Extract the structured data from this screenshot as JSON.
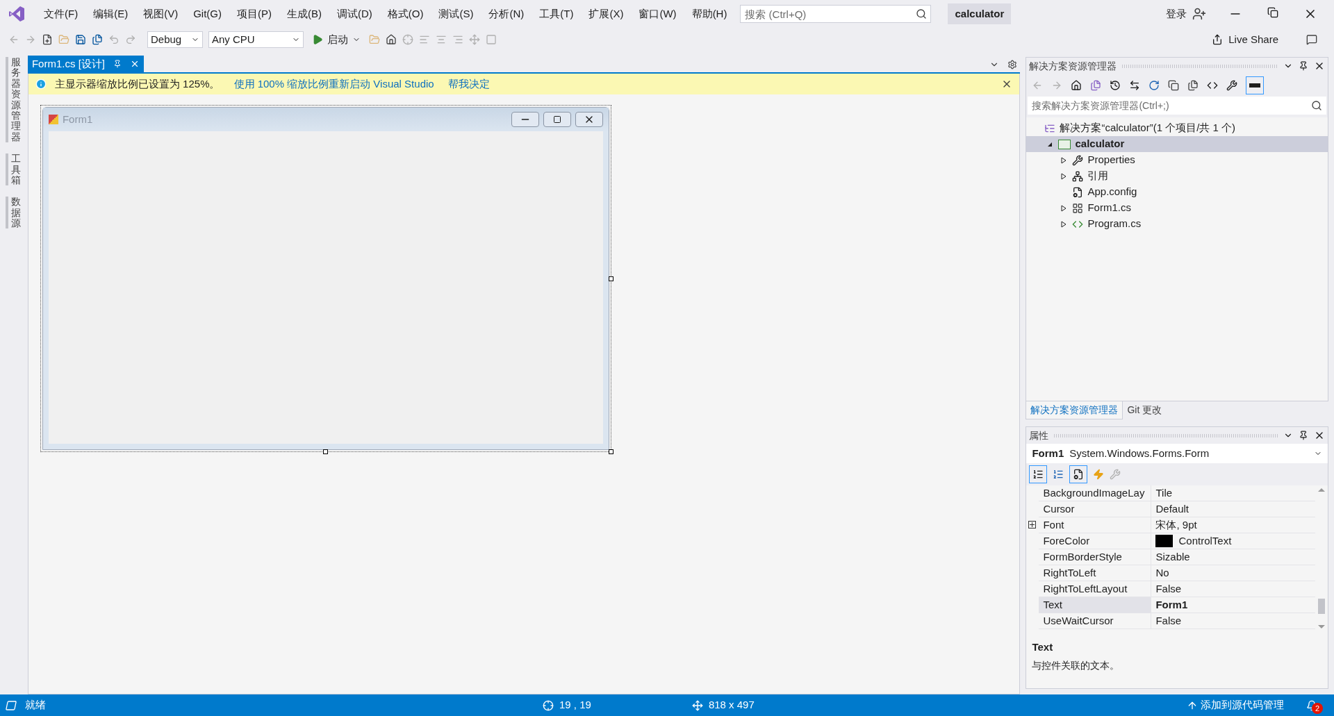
{
  "menu_bar": {
    "items": [
      "文件(F)",
      "编辑(E)",
      "视图(V)",
      "Git(G)",
      "项目(P)",
      "生成(B)",
      "调试(D)",
      "格式(O)",
      "测试(S)",
      "分析(N)",
      "工具(T)",
      "扩展(X)",
      "窗口(W)",
      "帮助(H)"
    ]
  },
  "search": {
    "placeholder": "搜索 (Ctrl+Q)"
  },
  "solution_name": "calculator",
  "account": {
    "sign_in": "登录"
  },
  "toolbar": {
    "configuration": "Debug",
    "platform": "Any CPU",
    "start": "启动",
    "live_share": "Live Share"
  },
  "side_tabs": [
    "服务器资源管理器",
    "工具箱",
    "数据源"
  ],
  "document_tab": {
    "label": "Form1.cs [设计]",
    "selected": true
  },
  "info_bar": {
    "message": "主显示器缩放比例已设置为 125%。",
    "links": [
      "使用 100% 缩放比例重新启动 Visual Studio",
      "帮我决定"
    ]
  },
  "designer": {
    "form_title": "Form1"
  },
  "solution_explorer": {
    "title": "解决方案资源管理器",
    "search_placeholder": "搜索解决方案资源管理器(Ctrl+;)",
    "tree": [
      {
        "label": "解决方案“calculator”(1 个项目/共 1 个)",
        "kind": "solution",
        "selected": false,
        "children": [
          {
            "label": "calculator",
            "kind": "project",
            "expanded": true,
            "selected": true,
            "children": [
              {
                "label": "Properties",
                "kind": "properties",
                "expanded": false,
                "selected": false
              },
              {
                "label": "引用",
                "kind": "references",
                "expanded": false,
                "selected": false
              },
              {
                "label": "App.config",
                "kind": "config",
                "selected": false
              },
              {
                "label": "Form1.cs",
                "kind": "form",
                "expanded": false,
                "selected": false
              },
              {
                "label": "Program.cs",
                "kind": "csharp",
                "expanded": false,
                "selected": false
              }
            ]
          }
        ]
      }
    ]
  },
  "bottom_tabs": [
    {
      "label": "解决方案资源管理器",
      "selected": true
    },
    {
      "label": "Git 更改",
      "selected": false
    }
  ],
  "properties": {
    "title": "属性",
    "object_name": "Form1",
    "object_type": "System.Windows.Forms.Form",
    "rows": [
      {
        "name": "BackgroundImageLay",
        "value": "Tile",
        "selected": false,
        "modified": false
      },
      {
        "name": "Cursor",
        "value": "Default",
        "selected": false,
        "modified": false
      },
      {
        "name": "Font",
        "value": "宋体, 9pt",
        "selected": false,
        "modified": false,
        "expanded": false
      },
      {
        "name": "ForeColor",
        "value": "ControlText",
        "selected": false,
        "modified": false,
        "color": "#000000"
      },
      {
        "name": "FormBorderStyle",
        "value": "Sizable",
        "selected": false,
        "modified": false
      },
      {
        "name": "RightToLeft",
        "value": "No",
        "selected": false,
        "modified": false
      },
      {
        "name": "RightToLeftLayout",
        "value": "False",
        "selected": false,
        "modified": false
      },
      {
        "name": "Text",
        "value": "Form1",
        "selected": true,
        "modified": true
      },
      {
        "name": "UseWaitCursor",
        "value": "False",
        "selected": false,
        "modified": false
      }
    ],
    "description": {
      "title": "Text",
      "text": "与控件关联的文本。"
    }
  },
  "status_bar": {
    "message": "就绪",
    "position": "19 , 19",
    "size": "818 x 497",
    "source_control": "添加到源代码管理",
    "notifications": "2"
  }
}
